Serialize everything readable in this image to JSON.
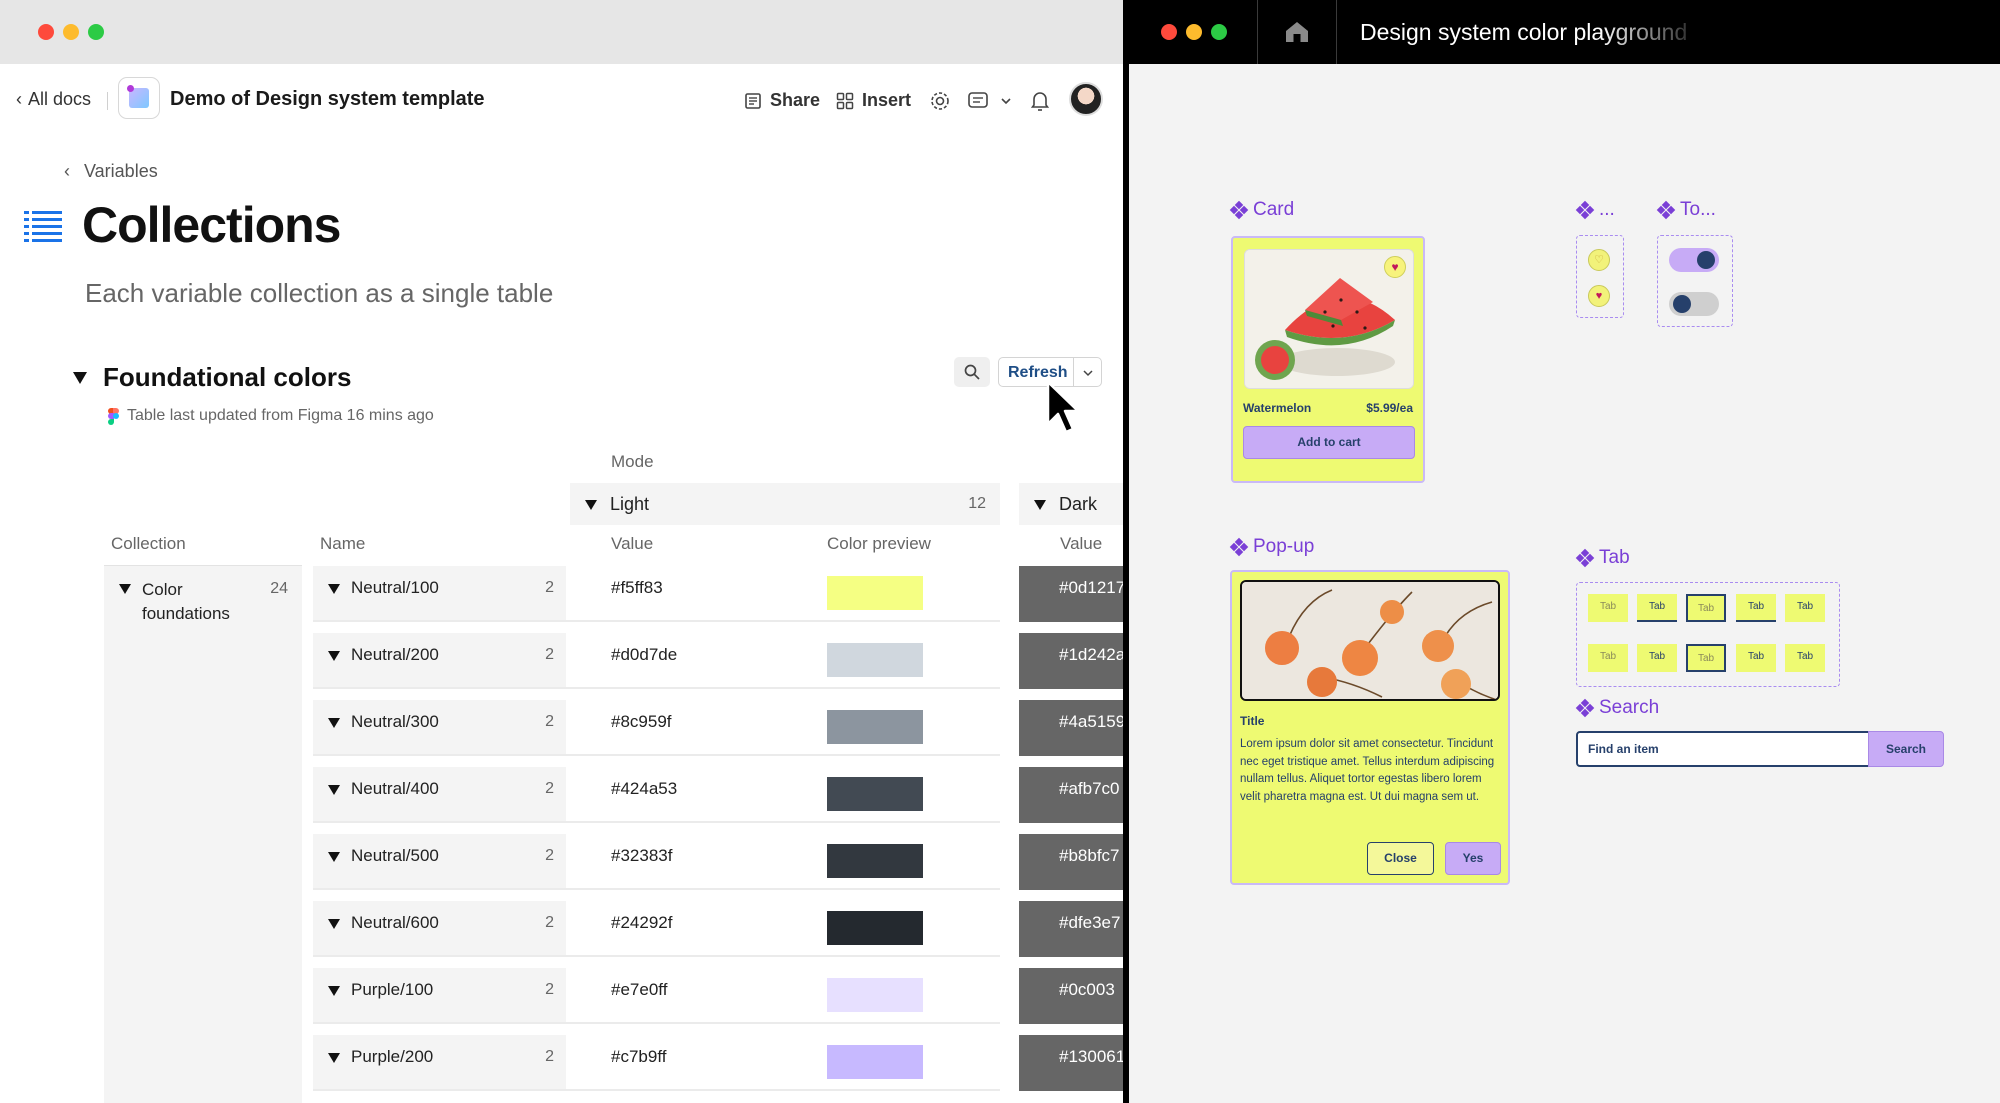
{
  "left_window": {
    "back_link": "All docs",
    "doc_title": "Demo of Design system template",
    "toolbar": {
      "share": "Share",
      "insert": "Insert"
    },
    "breadcrumb": "Variables",
    "page_title": "Collections",
    "page_subtitle": "Each variable collection as a single table",
    "section": {
      "title": "Foundational colors",
      "updated": "Table last updated from Figma 16 mins ago",
      "refresh_label": "Refresh"
    },
    "table": {
      "mode_label": "Mode",
      "modes": [
        {
          "label": "Light",
          "count": "12"
        },
        {
          "label": "Dark",
          "count": ""
        }
      ],
      "headers": {
        "collection": "Collection",
        "name": "Name",
        "value": "Value",
        "color_preview": "Color preview",
        "dark_value": "Value"
      },
      "collection": {
        "label": "Color foundations",
        "count": "24"
      },
      "rows": [
        {
          "name": "Neutral/100",
          "count": "2",
          "value": "#f5ff83",
          "swatch": "#f5ff83",
          "dark": "#0d1217"
        },
        {
          "name": "Neutral/200",
          "count": "2",
          "value": "#d0d7de",
          "swatch": "#d0d7de",
          "dark": "#1d242a"
        },
        {
          "name": "Neutral/300",
          "count": "2",
          "value": "#8c959f",
          "swatch": "#8c959f",
          "dark": "#4a5159"
        },
        {
          "name": "Neutral/400",
          "count": "2",
          "value": "#424a53",
          "swatch": "#424a53",
          "dark": "#afb7c0"
        },
        {
          "name": "Neutral/500",
          "count": "2",
          "value": "#32383f",
          "swatch": "#32383f",
          "dark": "#b8bfc7"
        },
        {
          "name": "Neutral/600",
          "count": "2",
          "value": "#24292f",
          "swatch": "#24292f",
          "dark": "#dfe3e7"
        },
        {
          "name": "Purple/100",
          "count": "2",
          "value": "#e7e0ff",
          "swatch": "#e7e0ff",
          "dark": "#0c003"
        },
        {
          "name": "Purple/200",
          "count": "2",
          "value": "#c7b9ff",
          "swatch": "#c7b9ff",
          "dark": "#130061"
        }
      ]
    }
  },
  "right_window": {
    "title": "Design system color playground",
    "components": {
      "card": {
        "label": "Card",
        "product_name": "Watermelon",
        "price": "$5.99/ea",
        "button": "Add to cart"
      },
      "favorite_label": "...",
      "toggle_label": "To...",
      "popup": {
        "label": "Pop-up",
        "title": "Title",
        "body": "Lorem ipsum dolor sit amet consectetur. Tincidunt nec eget tristique amet. Tellus interdum adipiscing nullam tellus. Aliquet tortor egestas libero lorem velit pharetra magna est. Ut dui magna sem ut.",
        "close": "Close",
        "yes": "Yes"
      },
      "tab": {
        "label": "Tab",
        "item": "Tab"
      },
      "search": {
        "label": "Search",
        "placeholder": "Find an item",
        "button": "Search"
      }
    }
  },
  "colors": {
    "accent_purple": "#7a3fd6",
    "component_yellow": "#eefa72",
    "component_lavender": "#c7abf6",
    "navy": "#26406b",
    "dark_cell": "#666666"
  }
}
